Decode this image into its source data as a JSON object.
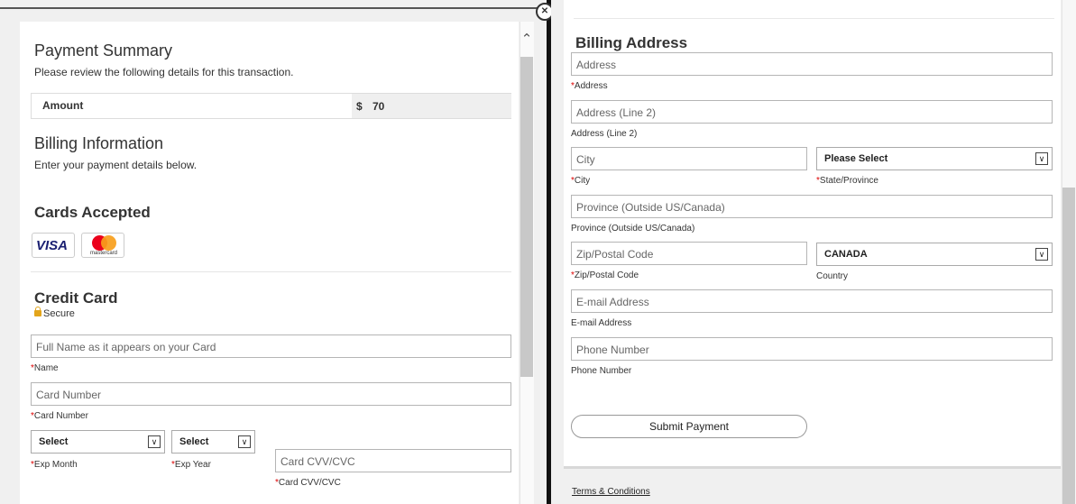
{
  "payment_summary": {
    "title": "Payment Summary",
    "subtitle": "Please review the following details for this transaction.",
    "amount_label": "Amount",
    "currency_symbol": "$",
    "amount_value": "70"
  },
  "billing_information": {
    "title": "Billing Information",
    "subtitle": "Enter your payment details below."
  },
  "cards_accepted": {
    "title": "Cards Accepted",
    "cards": [
      "VISA",
      "mastercard"
    ]
  },
  "credit_card": {
    "title": "Credit Card",
    "secure_label": "Secure",
    "name_placeholder": "Full Name as it appears on your Card",
    "name_label": "Name",
    "number_placeholder": "Card Number",
    "number_label": "Card Number",
    "exp_month_value": "Select",
    "exp_month_label": "Exp Month",
    "exp_year_value": "Select",
    "exp_year_label": "Exp Year",
    "cvv_placeholder": "Card CVV/CVC",
    "cvv_label": "Card CVV/CVC",
    "required_mark": "*"
  },
  "billing_address": {
    "title": "Billing Address",
    "address_placeholder": "Address",
    "address_label": "Address",
    "address2_placeholder": "Address (Line 2)",
    "address2_label": "Address (Line 2)",
    "city_placeholder": "City",
    "city_label": "City",
    "state_value": "Please Select",
    "state_label": "State/Province",
    "province_placeholder": "Province (Outside US/Canada)",
    "province_label": "Province (Outside US/Canada)",
    "zip_placeholder": "Zip/Postal Code",
    "zip_label": "Zip/Postal Code",
    "country_value": "CANADA",
    "country_label": "Country",
    "email_placeholder": "E-mail Address",
    "email_label": "E-mail Address",
    "phone_placeholder": "Phone Number",
    "phone_label": "Phone Number",
    "submit_label": "Submit Payment",
    "terms_label": "Terms & Conditions"
  },
  "icons": {
    "close": "close-icon",
    "scroll_up": "chevron-up-icon",
    "lock": "lock-icon",
    "dropdown": "chevron-down-icon",
    "select_arrow_glyph": "∨",
    "scroll_up_glyph": "⌃",
    "close_glyph": "✕"
  },
  "colors": {
    "required": "#dd0000",
    "visa": "#1a1f71",
    "mastercard_red": "#eb001b",
    "mastercard_yellow": "#f79e1b",
    "lock": "#e3a51b"
  }
}
